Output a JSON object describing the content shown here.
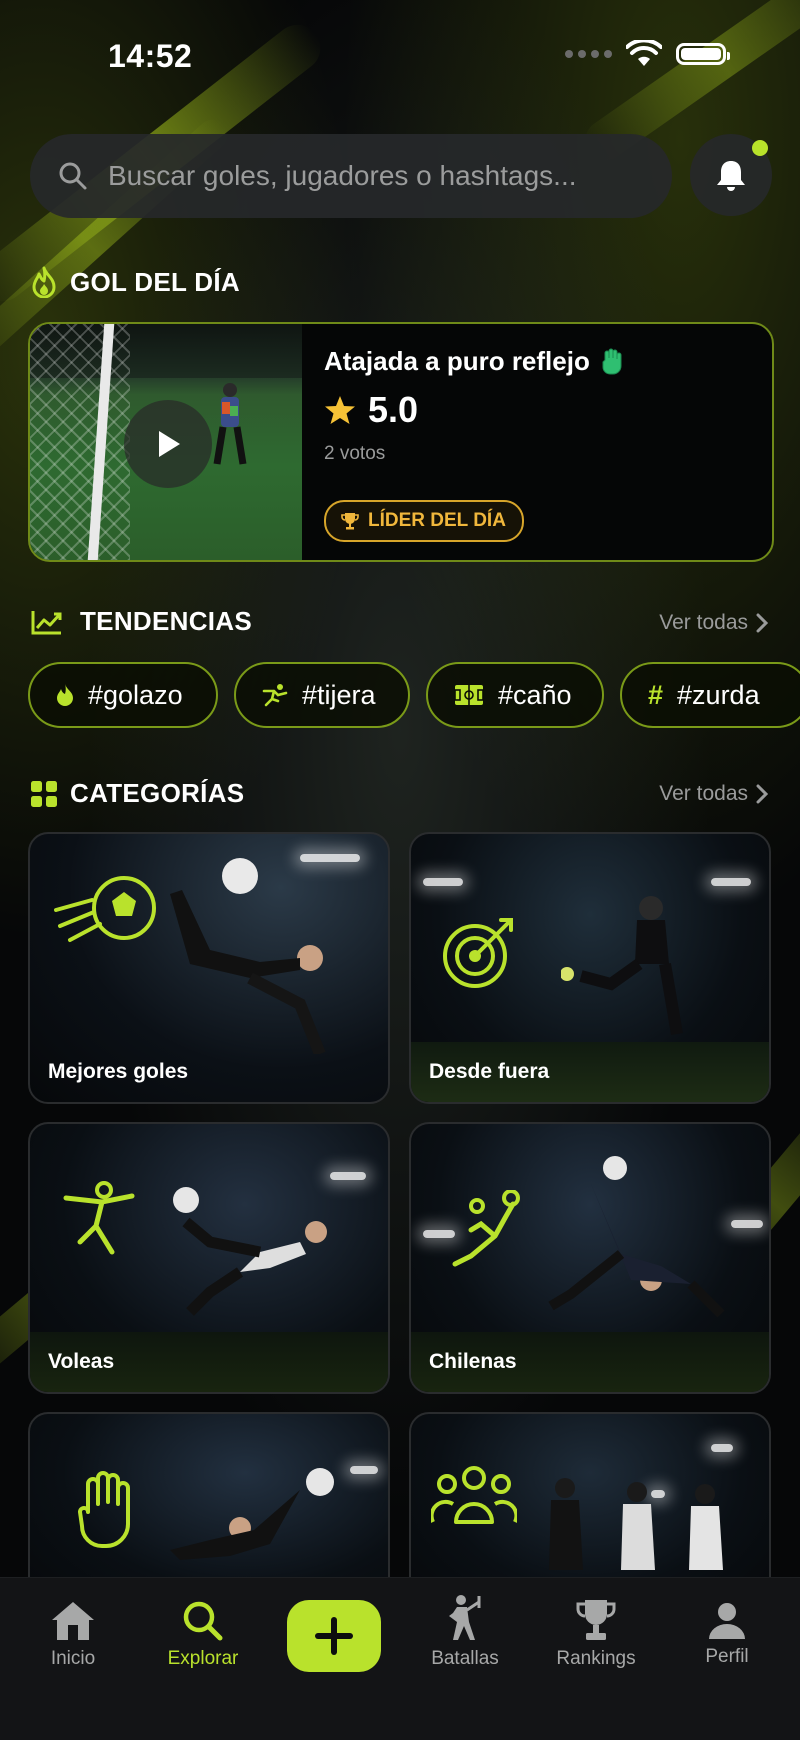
{
  "status_bar": {
    "time": "14:52"
  },
  "search": {
    "placeholder": "Buscar goles, jugadores o hashtags..."
  },
  "goal_of_day": {
    "section_title": "GOL DEL DÍA",
    "title": "Atajada a puro reflejo",
    "rating": "5.0",
    "votes": "2 votos",
    "badge": "LÍDER DEL DÍA"
  },
  "trends": {
    "section_title": "TENDENCIAS",
    "see_all": "Ver todas",
    "tags": [
      {
        "label": "#golazo",
        "icon": "flame-icon"
      },
      {
        "label": "#tijera",
        "icon": "kick-icon"
      },
      {
        "label": "#caño",
        "icon": "pitch-icon"
      },
      {
        "label": "#zurda",
        "icon": "hash-icon"
      }
    ]
  },
  "categories": {
    "section_title": "CATEGORÍAS",
    "see_all": "Ver todas",
    "items": [
      {
        "label": "Mejores goles",
        "icon": "flying-ball-icon"
      },
      {
        "label": "Desde fuera",
        "icon": "target-icon"
      },
      {
        "label": "Voleas",
        "icon": "volley-player-icon"
      },
      {
        "label": "Chilenas",
        "icon": "bicycle-kick-icon"
      },
      {
        "label": "",
        "icon": "goalkeeper-glove-icon"
      },
      {
        "label": "",
        "icon": "team-icon"
      }
    ]
  },
  "nav": {
    "items": [
      {
        "label": "Inicio",
        "icon": "home-icon"
      },
      {
        "label": "Explorar",
        "icon": "search-icon"
      },
      {
        "label": "Batallas",
        "icon": "battle-icon"
      },
      {
        "label": "Rankings",
        "icon": "trophy-icon"
      },
      {
        "label": "Perfil",
        "icon": "person-icon"
      }
    ]
  },
  "colors": {
    "accent": "#b9e22c",
    "gold": "#f0b73c",
    "background": "#07080a"
  }
}
